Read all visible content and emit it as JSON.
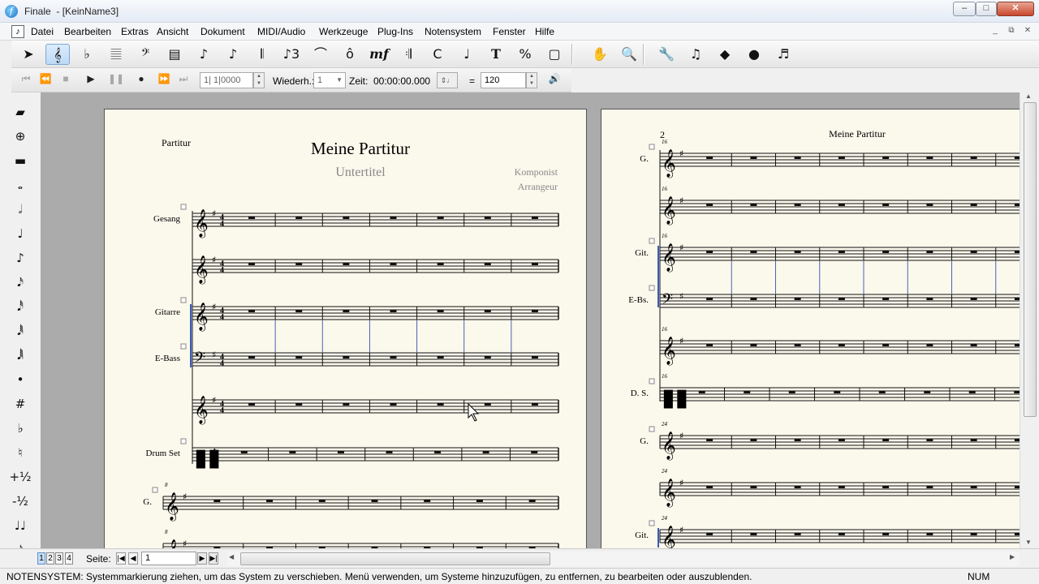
{
  "window": {
    "app_name": "Finale",
    "doc_title": "- [KeinName3]",
    "min": "–",
    "max": "□",
    "close": "✕"
  },
  "menu": {
    "items": [
      "Datei",
      "Bearbeiten",
      "Extras",
      "Ansicht",
      "Dokument",
      "MIDI/Audio",
      "Werkzeuge",
      "Plug-Ins",
      "Notensystem",
      "Fenster",
      "Hilfe"
    ],
    "mdi": [
      "_",
      "⧉",
      "✕"
    ]
  },
  "toolbar": {
    "tools": [
      {
        "name": "selection-tool-icon",
        "glyph": "➤"
      },
      {
        "name": "staff-tool-icon",
        "glyph": "𝄞"
      },
      {
        "name": "key-signature-tool-icon",
        "glyph": "♭"
      },
      {
        "name": "time-signature-tool-icon",
        "glyph": "𝄚"
      },
      {
        "name": "clef-tool-icon",
        "glyph": "𝄢"
      },
      {
        "name": "measure-tool-icon",
        "glyph": "▤"
      },
      {
        "name": "simple-entry-tool-icon",
        "glyph": "♪"
      },
      {
        "name": "speedy-entry-tool-icon",
        "glyph": "♪"
      },
      {
        "name": "hyperscribe-tool-icon",
        "glyph": "𝄃"
      },
      {
        "name": "tuplet-tool-icon",
        "glyph": "♪3"
      },
      {
        "name": "smart-shape-tool-icon",
        "glyph": "⌒"
      },
      {
        "name": "articulation-tool-icon",
        "glyph": "ô"
      },
      {
        "name": "expression-tool-icon",
        "glyph": "mf"
      },
      {
        "name": "repeat-tool-icon",
        "glyph": "𝄇"
      },
      {
        "name": "chord-tool-icon",
        "glyph": "C"
      },
      {
        "name": "lyrics-tool-icon",
        "glyph": "♩"
      },
      {
        "name": "text-tool-icon",
        "glyph": "T"
      },
      {
        "name": "resize-tool-icon",
        "glyph": "%"
      },
      {
        "name": "page-layout-tool-icon",
        "glyph": "▢"
      },
      {
        "name": "hand-grabber-icon",
        "glyph": "✋"
      },
      {
        "name": "zoom-tool-icon",
        "glyph": "🔍"
      },
      {
        "name": "special-tools-icon",
        "glyph": "🔧"
      },
      {
        "name": "midi-tool-icon",
        "glyph": "♫"
      },
      {
        "name": "mass-edit-tool-icon",
        "glyph": "◆"
      },
      {
        "name": "midi-audio-tool-icon",
        "glyph": "●"
      },
      {
        "name": "ossia-tool-icon",
        "glyph": "♬"
      }
    ]
  },
  "playback": {
    "position": "1| 1|0000",
    "repeat_label": "Wiederh.:",
    "repeat_value": "1",
    "time_label": "Zeit:",
    "time_value": "00:00:00.000",
    "equals": "=",
    "tempo": "120"
  },
  "palette": {
    "items": [
      "eraser-icon",
      "tie-icon",
      "rest-icon",
      "whole-note-icon",
      "half-note-icon",
      "quarter-note-icon",
      "eighth-note-icon",
      "sixteenth-note-icon",
      "thirty-second-note-icon",
      "sixty-fourth-note-icon",
      "hundred-twenty-eighth-note-icon",
      "augmentation-dot-icon",
      "sharp-icon",
      "flat-icon",
      "natural-icon",
      "half-step-up-icon",
      "half-step-down-icon",
      "tie-toggle-icon",
      "tuplet-icon"
    ],
    "glyphs": [
      "▰",
      "⊕",
      "▬",
      "𝅝",
      "𝅗𝅥",
      "♩",
      "♪",
      "𝅘𝅥𝅯",
      "𝅘𝅥𝅰",
      "𝅘𝅥𝅱",
      "𝅘𝅥𝅲",
      "•",
      "#",
      "♭",
      "♮",
      "+½",
      "-½",
      "♩♩",
      "𝅘𝅥𝅮"
    ]
  },
  "score_page1": {
    "header_left": "Partitur",
    "title": "Meine Partitur",
    "subtitle": "Untertitel",
    "composer": "Komponist",
    "arranger": "Arrangeur",
    "staves": [
      {
        "label": "Gesang",
        "clef": "treble"
      },
      {
        "label": "",
        "clef": "treble"
      },
      {
        "label": "Gitarre",
        "clef": "treble"
      },
      {
        "label": "E-Bass",
        "clef": "bass"
      },
      {
        "label": "",
        "clef": "treble"
      },
      {
        "label": "Drum Set",
        "clef": "percussion"
      }
    ],
    "system2_label": "G.",
    "system2_measure": "8",
    "system3_measure": "8"
  },
  "score_page2": {
    "page_number": "2",
    "header": "Meine Partitur",
    "staves": [
      {
        "label": "G.",
        "measure": "16",
        "clef": "treble"
      },
      {
        "label": "",
        "measure": "16",
        "clef": "treble"
      },
      {
        "label": "Git.",
        "measure": "16",
        "clef": "treble"
      },
      {
        "label": "E-Bs.",
        "measure": "",
        "clef": "bass"
      },
      {
        "label": "",
        "measure": "16",
        "clef": "treble"
      },
      {
        "label": "D. S.",
        "measure": "16",
        "clef": "percussion"
      },
      {
        "label": "G.",
        "measure": "24",
        "clef": "treble"
      },
      {
        "label": "",
        "measure": "24",
        "clef": "treble"
      },
      {
        "label": "Git.",
        "measure": "24",
        "clef": "treble"
      }
    ]
  },
  "pagebar": {
    "pages": [
      "1",
      "2",
      "3",
      "4"
    ],
    "page_label": "Seite:",
    "page_value": "1"
  },
  "status": {
    "text": "NOTENSYSTEM: Systemmarkierung ziehen, um das System zu verschieben. Menü verwenden, um Systeme hinzuzufügen, zu entfernen, zu bearbeiten oder auszublenden.",
    "num": "NUM"
  }
}
